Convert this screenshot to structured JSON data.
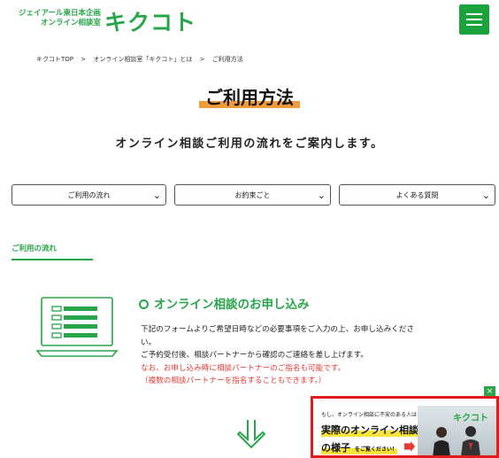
{
  "header": {
    "brand_line1": "ジェイアール東日本企画",
    "brand_line2": "オンライン相談室",
    "logo": "キクコト",
    "menu_icon": "hamburger-icon"
  },
  "breadcrumb": [
    "キクコトTOP",
    ">",
    "オンライン相談室「キクコト」とは",
    ">",
    "ご利用方法"
  ],
  "page": {
    "title": "ご利用方法",
    "subtitle": "オンライン相談ご利用の流れをご案内します。"
  },
  "selects": [
    {
      "label": "ご利用の流れ"
    },
    {
      "label": "お約束ごと"
    },
    {
      "label": "よくある質問"
    }
  ],
  "section": {
    "label": "ご利用の流れ"
  },
  "step": {
    "title": "オンライン相談のお申し込み",
    "line1": "下記のフォームよりご希望日時などの必要事項をご入力の上、お申し込みくださ",
    "line2": "い。",
    "line3": "ご予約受付後、相談パートナーから確認のご連絡を差し上げます。",
    "line4": "なお、お申し込み時に相談パートナーのご指名も可能です。",
    "line5": "（複数の相談パートナーを指名することもできます。）"
  },
  "ad": {
    "small": "もし、オンライン相談に不安のある人は",
    "main1": "実際のオンライン相談",
    "main2": "の様子",
    "cta": "をご覧ください！",
    "logo": "キクコト",
    "close": "×"
  },
  "colors": {
    "accent": "#2aa54a",
    "highlight": "#f29b3a",
    "alert": "#e53935",
    "ad_border": "#e21c1c"
  }
}
